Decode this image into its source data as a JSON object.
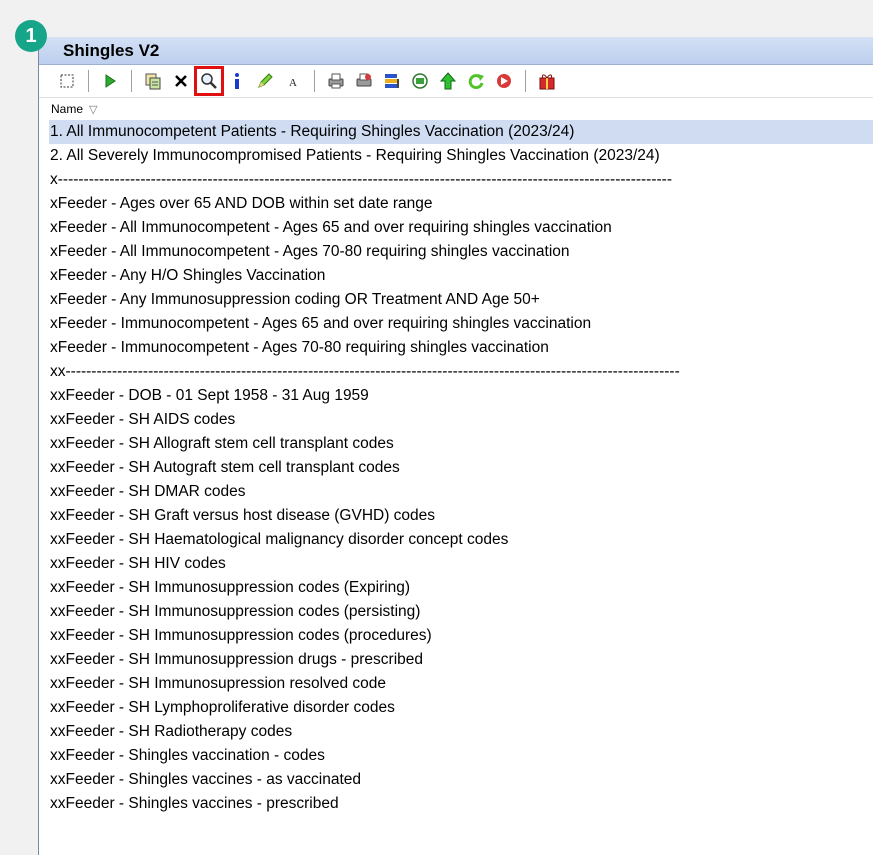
{
  "badge": {
    "number": "1"
  },
  "window": {
    "title": "Shingles V2"
  },
  "toolbar": {
    "buttons": [
      {
        "name": "select-icon"
      },
      {
        "name": "run-icon"
      },
      {
        "name": "copy-icon"
      },
      {
        "name": "delete-icon"
      },
      {
        "name": "search-icon",
        "highlighted": true
      },
      {
        "name": "info-icon"
      },
      {
        "name": "edit-icon"
      },
      {
        "name": "font-icon"
      },
      {
        "name": "print-icon"
      },
      {
        "name": "print-preview-icon"
      },
      {
        "name": "report-icon"
      },
      {
        "name": "export-icon"
      },
      {
        "name": "move-up-icon"
      },
      {
        "name": "refresh-icon"
      },
      {
        "name": "forward-icon"
      },
      {
        "name": "gift-icon"
      }
    ]
  },
  "list": {
    "header": "Name",
    "sort_glyph": "▽",
    "selected_index": 0,
    "items": [
      "1. All Immunocompetent Patients -  Requiring Shingles Vaccination (2023/24)",
      "2. All Severely Immunocompromised Patients - Requiring Shingles Vaccination (2023/24)",
      "x-----------------------------------------------------------------------------------------------------------------------",
      "xFeeder - Ages over 65 AND DOB within set date range",
      "xFeeder - All Immunocompetent - Ages 65 and over requiring shingles vaccination",
      "xFeeder - All Immunocompetent - Ages 70-80 requiring shingles vaccination",
      "xFeeder - Any H/O Shingles Vaccination",
      "xFeeder - Any Immunosuppression coding OR Treatment AND Age 50+",
      "xFeeder - Immunocompetent - Ages 65 and over requiring shingles vaccination",
      "xFeeder - Immunocompetent - Ages 70-80 requiring shingles vaccination",
      "xx-----------------------------------------------------------------------------------------------------------------------",
      "xxFeeder - DOB - 01 Sept 1958 - 31 Aug 1959",
      "xxFeeder - SH AIDS codes",
      "xxFeeder - SH Allograft stem cell transplant codes",
      "xxFeeder - SH Autograft stem cell transplant codes",
      "xxFeeder - SH DMAR codes",
      "xxFeeder - SH Graft versus host disease (GVHD) codes",
      "xxFeeder - SH Haematological malignancy disorder concept codes",
      "xxFeeder - SH HIV codes",
      "xxFeeder - SH Immunosuppression codes (Expiring)",
      "xxFeeder - SH Immunosuppression codes (persisting)",
      "xxFeeder - SH Immunosuppression codes (procedures)",
      "xxFeeder - SH Immunosuppression drugs - prescribed",
      "xxFeeder - SH Immunosupression resolved code",
      "xxFeeder - SH Lymphoproliferative disorder codes",
      "xxFeeder - SH Radiotherapy codes",
      "xxFeeder - Shingles vaccination - codes",
      "xxFeeder - Shingles vaccines - as vaccinated",
      "xxFeeder - Shingles vaccines - prescribed"
    ]
  }
}
